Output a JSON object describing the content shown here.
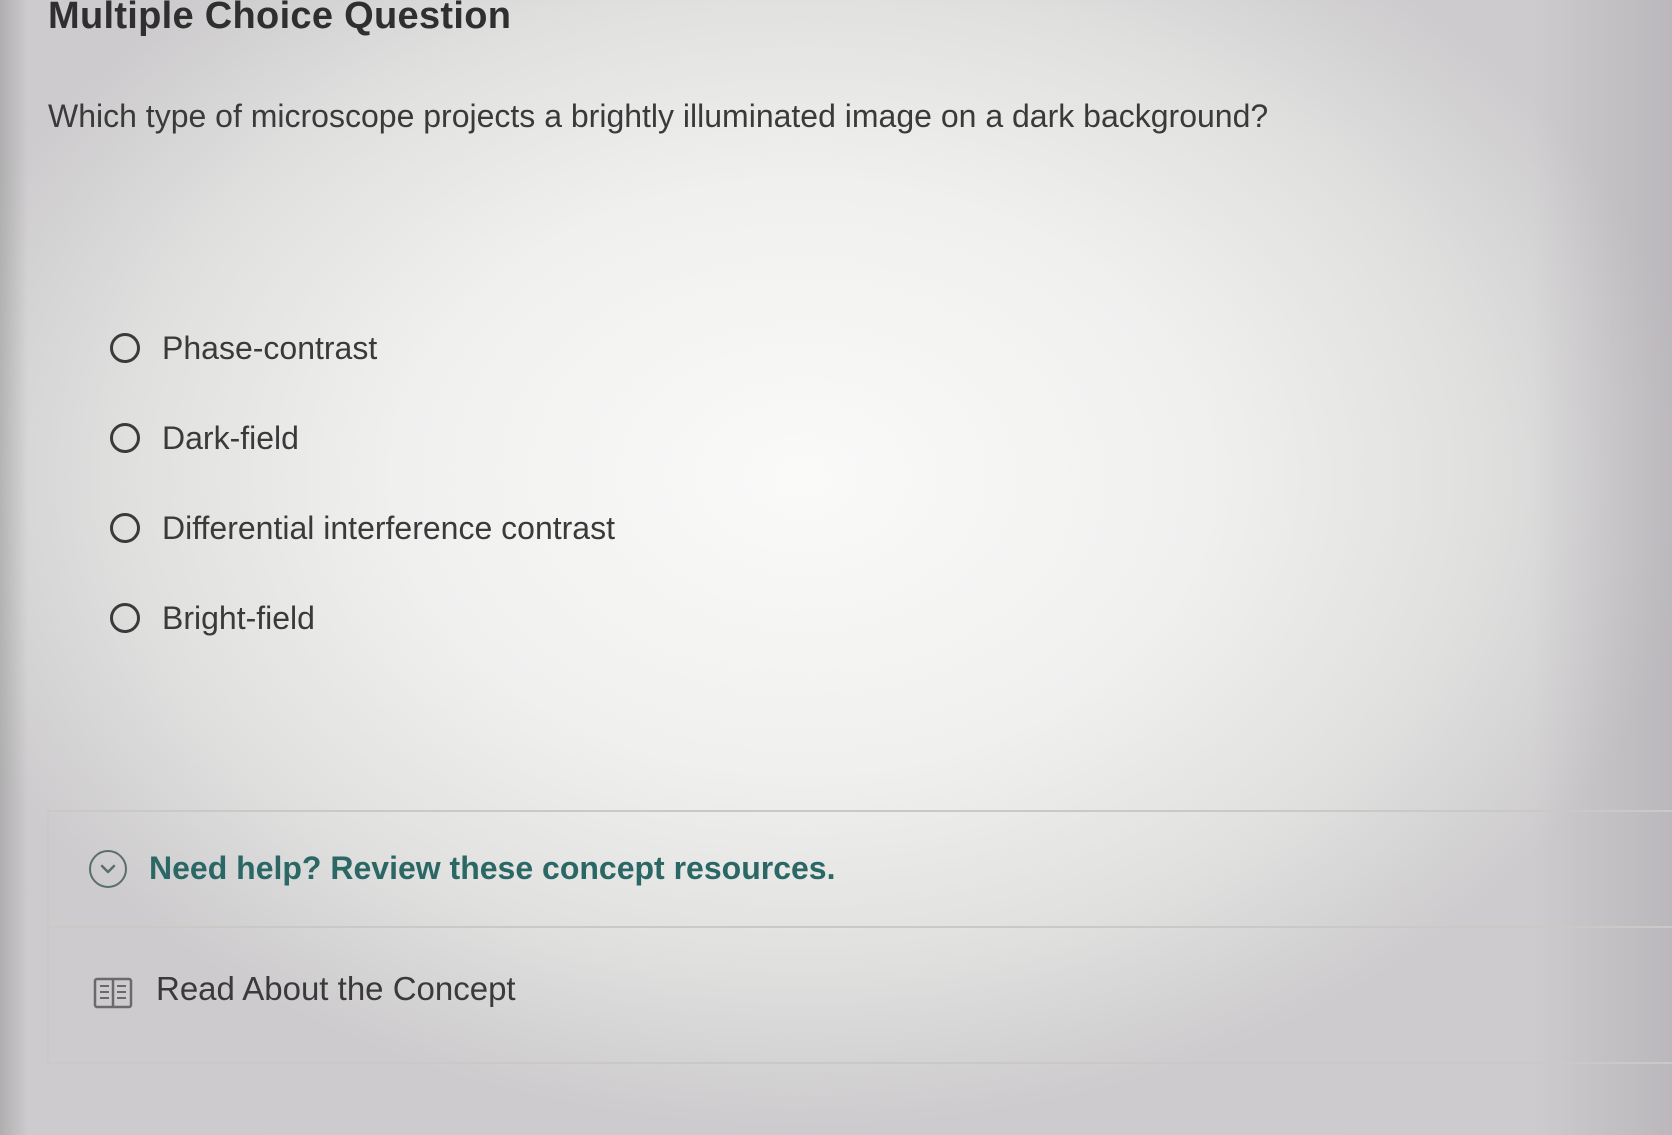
{
  "page": {
    "title": "Multiple Choice Question"
  },
  "question": {
    "text": "Which type of microscope projects a brightly illuminated image on a dark background?"
  },
  "options": [
    {
      "label": "Phase-contrast",
      "selected": false
    },
    {
      "label": "Dark-field",
      "selected": false
    },
    {
      "label": "Differential interference contrast",
      "selected": false
    },
    {
      "label": "Bright-field",
      "selected": false
    }
  ],
  "help": {
    "header": "Need help? Review these concept resources.",
    "header_icon": "chevron-down-circle-icon",
    "resources": [
      {
        "label": "Read About the Concept",
        "icon": "book-icon"
      }
    ]
  },
  "colors": {
    "help_text": "#2b6765",
    "text": "#3a3a3a"
  }
}
